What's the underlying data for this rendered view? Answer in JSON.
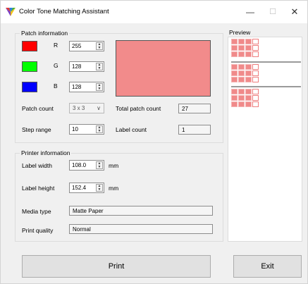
{
  "window": {
    "title": "Color Tone Matching Assistant"
  },
  "titlebar": {
    "minimize": "—",
    "maximize": "☐",
    "close": "✕"
  },
  "patch": {
    "heading": "Patch information",
    "rgb": [
      {
        "label": "R",
        "value": "255",
        "color": "#ff0000"
      },
      {
        "label": "G",
        "value": "128",
        "color": "#00ff00"
      },
      {
        "label": "B",
        "value": "128",
        "color": "#0000ff"
      }
    ],
    "preview_color": "#f28b8b",
    "patch_count_label": "Patch count",
    "patch_count_value": "3 x 3",
    "total_patch_count_label": "Total patch count",
    "total_patch_count_value": "27",
    "step_range_label": "Step range",
    "step_range_value": "10",
    "label_count_label": "Label count",
    "label_count_value": "1"
  },
  "printer": {
    "heading": "Printer information",
    "label_width_label": "Label width",
    "label_width_value": "108.0",
    "label_width_unit": "mm",
    "label_height_label": "Label height",
    "label_height_value": "152.4",
    "label_height_unit": "mm",
    "media_type_label": "Media type",
    "media_type_value": "Matte Paper",
    "print_quality_label": "Print quality",
    "print_quality_value": "Normal"
  },
  "preview": {
    "heading": "Preview"
  },
  "buttons": {
    "print": "Print",
    "exit": "Exit"
  }
}
